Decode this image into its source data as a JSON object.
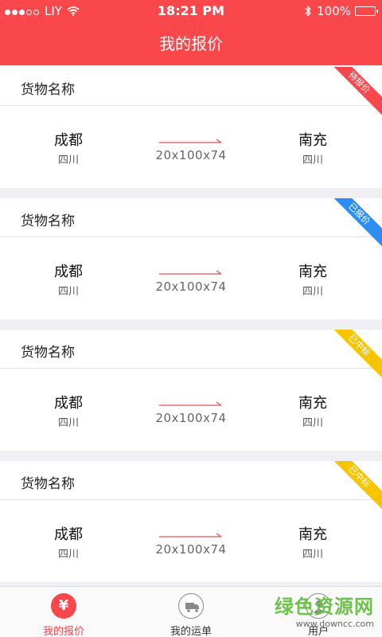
{
  "status_bar": {
    "carrier": "LIY",
    "time": "18:21 PM",
    "battery": "100%"
  },
  "header": {
    "title": "我的报价"
  },
  "quotes": [
    {
      "title": "货物名称",
      "from_city": "成都",
      "from_province": "四川",
      "dimensions": "20x100x74",
      "to_city": "南充",
      "to_province": "四川",
      "status": "待报价",
      "status_color": "#f9474c"
    },
    {
      "title": "货物名称",
      "from_city": "成都",
      "from_province": "四川",
      "dimensions": "20x100x74",
      "to_city": "南充",
      "to_province": "四川",
      "status": "已报价",
      "status_color": "#2b8ef2"
    },
    {
      "title": "货物名称",
      "from_city": "成都",
      "from_province": "四川",
      "dimensions": "20x100x74",
      "to_city": "南充",
      "to_province": "四川",
      "status": "已中标",
      "status_color": "#f7c400"
    },
    {
      "title": "货物名称",
      "from_city": "成都",
      "from_province": "四川",
      "dimensions": "20x100x74",
      "to_city": "南充",
      "to_province": "四川",
      "status": "已中标",
      "status_color": "#f7c400"
    }
  ],
  "tab_bar": {
    "tabs": [
      {
        "label": "我的报价",
        "icon": "yen-icon",
        "glyph": "¥",
        "active": true
      },
      {
        "label": "我的运单",
        "icon": "truck-icon",
        "active": false
      },
      {
        "label": "用户",
        "icon": "user-icon",
        "active": false
      }
    ]
  },
  "watermark": {
    "main": "绿色资源网",
    "sub": "www.downcc.com"
  },
  "colors": {
    "accent": "#f9474c",
    "arrow": "#e85050"
  }
}
